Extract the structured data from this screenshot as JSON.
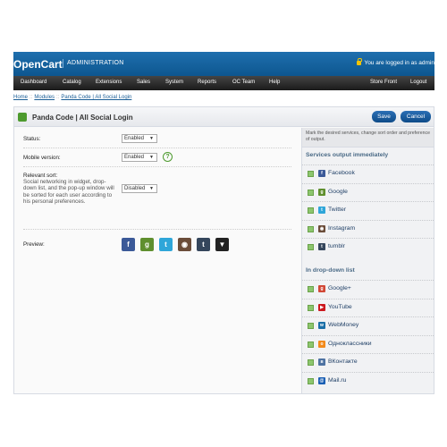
{
  "header": {
    "brand": "OpenCart",
    "subtitle": "ADMINISTRATION",
    "login_text": "You are logged in as admin"
  },
  "menu": {
    "left": [
      "Dashboard",
      "Catalog",
      "Extensions",
      "Sales",
      "System",
      "Reports",
      "OC Team",
      "Help"
    ],
    "right": [
      "Store Front",
      "Logout"
    ]
  },
  "breadcrumb": [
    "Home",
    "Modules",
    "Panda Code | All Social Login"
  ],
  "page": {
    "title": "Panda Code | All Social Login",
    "save_label": "Save",
    "cancel_label": "Cancel"
  },
  "form": {
    "status_label": "Status:",
    "status_value": "Enabled",
    "mobile_label": "Mobile version:",
    "mobile_value": "Enabled",
    "help_symbol": "?",
    "sort_label": "Relevant sort:",
    "sort_hint": "Social networking in widget, drop-down list, and the pop-up window will be sorted for each user according to his personal preferences.",
    "sort_value": "Disabled",
    "preview_label": "Preview:"
  },
  "preview_icons": [
    {
      "glyph": "f",
      "color": "#3b5998",
      "name": "facebook-icon"
    },
    {
      "glyph": "g",
      "color": "#5f8f2e",
      "name": "google-icon"
    },
    {
      "glyph": "t",
      "color": "#2fa6d9",
      "name": "twitter-icon"
    },
    {
      "glyph": "◉",
      "color": "#6b4d3a",
      "name": "instagram-icon"
    },
    {
      "glyph": "t",
      "color": "#35465c",
      "name": "tumblr-icon"
    },
    {
      "glyph": "▼",
      "color": "#222222",
      "name": "more-dropdown-icon"
    }
  ],
  "right": {
    "hint": "Mark the desired services, change sort order and preference of output.",
    "immediate_title": "Services output immediately",
    "immediate": [
      {
        "label": "Facebook",
        "glyph": "f",
        "color": "#3b5998"
      },
      {
        "label": "Google",
        "glyph": "g",
        "color": "#5f8f2e"
      },
      {
        "label": "Twitter",
        "glyph": "t",
        "color": "#2fa6d9"
      },
      {
        "label": "Instagram",
        "glyph": "◉",
        "color": "#6b4d3a"
      },
      {
        "label": "tumblr",
        "glyph": "t",
        "color": "#35465c"
      }
    ],
    "dropdown_title": "In drop-down list",
    "dropdown": [
      {
        "label": "Google+",
        "glyph": "g",
        "color": "#d14836"
      },
      {
        "label": "YouTube",
        "glyph": "▶",
        "color": "#cc181e"
      },
      {
        "label": "WebMoney",
        "glyph": "w",
        "color": "#1b6fa8"
      },
      {
        "label": "Одноклассники",
        "glyph": "o",
        "color": "#f28a1c"
      },
      {
        "label": "ВКонтакте",
        "glyph": "в",
        "color": "#4d72a2"
      },
      {
        "label": "Mail.ru",
        "glyph": "@",
        "color": "#1a5fb4"
      }
    ]
  }
}
